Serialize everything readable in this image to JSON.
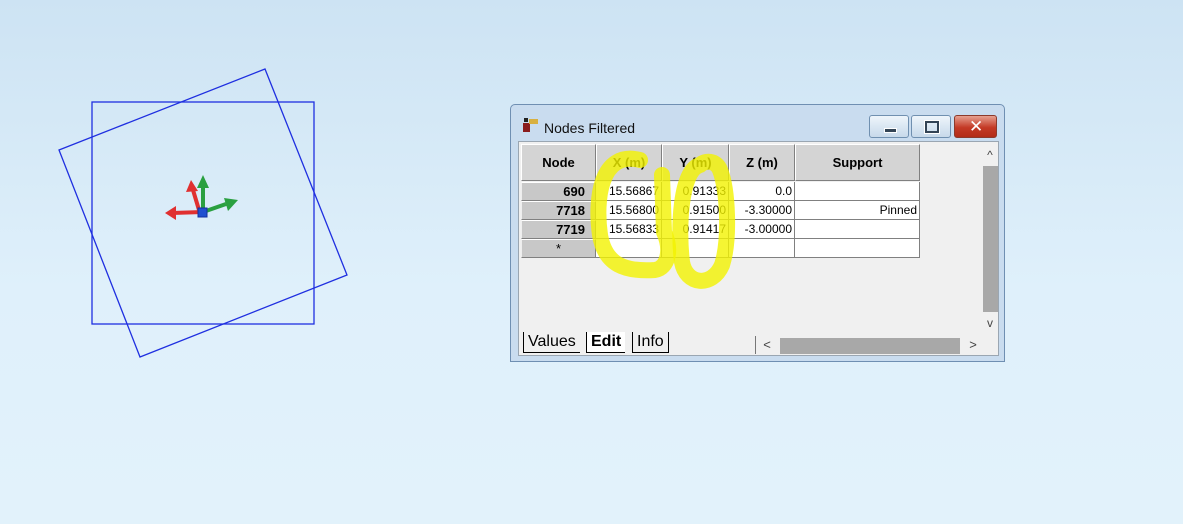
{
  "window": {
    "title": "Nodes Filtered",
    "controls": {
      "minimize": "—",
      "maximize": "□",
      "close": "✕"
    }
  },
  "grid": {
    "columns": [
      "Node",
      "X (m)",
      "Y (m)",
      "Z (m)",
      "Support"
    ],
    "rows": [
      {
        "node": "690",
        "x": "15.56867",
        "y": "0.91333",
        "z": "0.0",
        "support": ""
      },
      {
        "node": "7718",
        "x": "15.56800",
        "y": "0.91500",
        "z": "-3.30000",
        "support": "Pinned"
      },
      {
        "node": "7719",
        "x": "15.56833",
        "y": "0.91417",
        "z": "-3.00000",
        "support": ""
      }
    ],
    "new_row_marker": "*"
  },
  "tabs": [
    "Values",
    "Edit",
    "Info"
  ],
  "active_tab": "Edit",
  "colors": {
    "viewport_bg": "#d6ebf8",
    "outline_blue": "#1f2fe0",
    "axis_x": "#e03030",
    "axis_y": "#2aa040",
    "axis_z": "#2050d0",
    "highlight": "#f2f200"
  },
  "scroll_glyphs": {
    "up": "^",
    "down": "v",
    "left": "<",
    "right": ">"
  }
}
